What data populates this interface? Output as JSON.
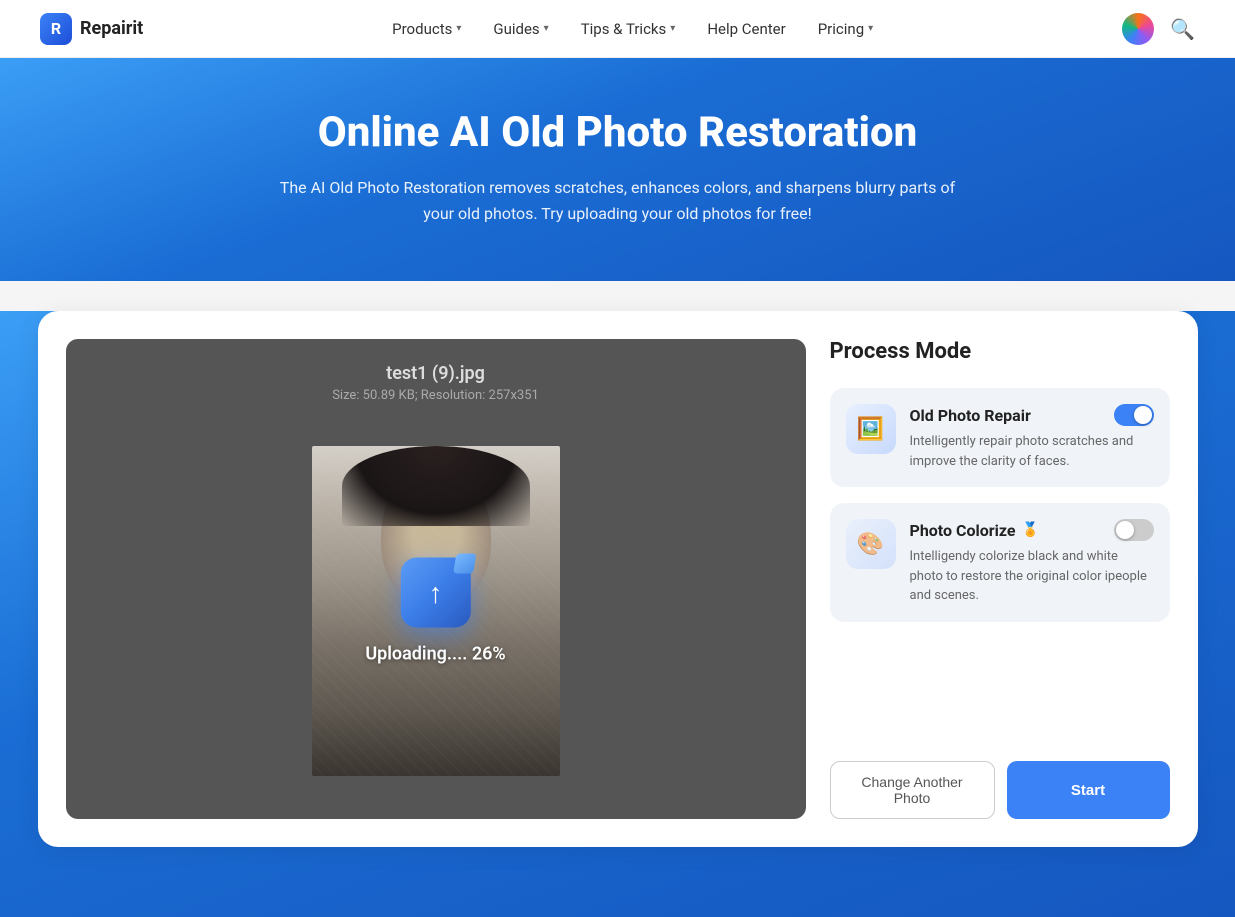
{
  "nav": {
    "logo_text": "Repairit",
    "items": [
      {
        "label": "Products",
        "has_chevron": true
      },
      {
        "label": "Guides",
        "has_chevron": true
      },
      {
        "label": "Tips & Tricks",
        "has_chevron": true
      },
      {
        "label": "Help Center",
        "has_chevron": false
      },
      {
        "label": "Pricing",
        "has_chevron": true
      }
    ]
  },
  "hero": {
    "title": "Online AI Old Photo Restoration",
    "description": "The AI Old Photo Restoration removes scratches, enhances colors, and sharpens blurry parts of your old photos. Try uploading your old photos for free!"
  },
  "upload": {
    "filename": "test1 (9).jpg",
    "meta": "Size: 50.89 KB; Resolution: 257x351",
    "progress_text": "Uploading.... 26%"
  },
  "sidebar": {
    "process_mode_title": "Process Mode",
    "modes": [
      {
        "name": "Old Photo Repair",
        "description": "Intelligently repair photo scratches and improve the clarity of faces.",
        "toggle_on": true,
        "icon": "🖼️"
      },
      {
        "name": "Photo Colorize",
        "description": "Intelligendy colorize black and white photo to restore the original color ipeople and scenes.",
        "toggle_on": false,
        "icon": "🎨",
        "has_crown": true
      }
    ],
    "btn_change": "Change Another Photo",
    "btn_start": "Start"
  }
}
